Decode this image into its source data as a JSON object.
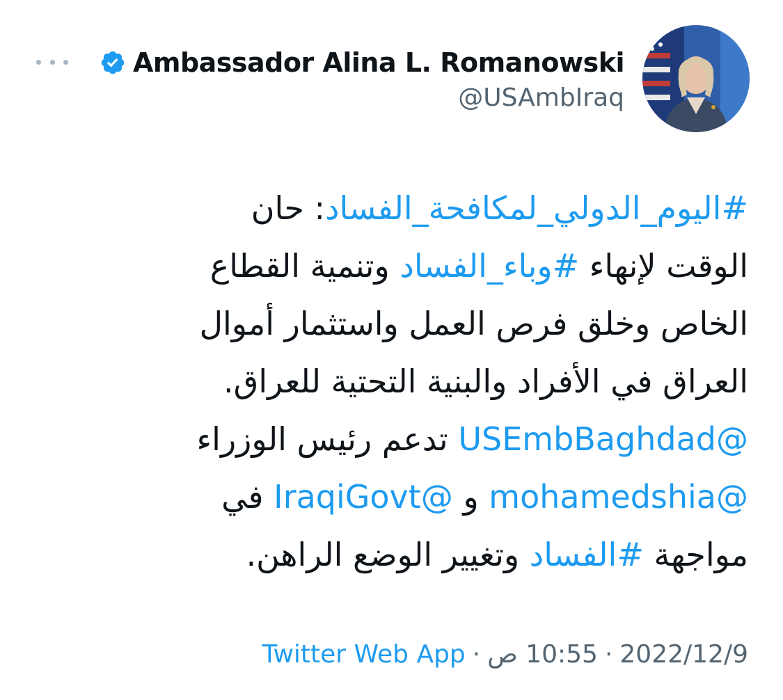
{
  "author": {
    "display_name": "Ambassador Alina L. Romanowski",
    "handle": "@USAmbIraq",
    "verified": true
  },
  "tweet": {
    "line1": {
      "hashtag": "#اليوم_الدولي_لمكافحة_الفساد",
      "text": ": حان"
    },
    "line2": {
      "before": "الوقت لإنهاء ",
      "hashtag": "#وباء_الفساد",
      "after": " وتنمية القطاع"
    },
    "line3": "الخاص وخلق فرص العمل واستثمار أموال",
    "line4": "العراق في الأفراد والبنية التحتية للعراق.",
    "line5": {
      "mention": "@USEmbBaghdad",
      "text": " تدعم رئيس الوزراء"
    },
    "line6": {
      "mention1": "@mohamedshia",
      "and": " و ",
      "mention2": "@IraqiGovt",
      "after": " في"
    },
    "line7": {
      "before": "مواجهة ",
      "hashtag": "#الفساد",
      "after": " وتغيير الوضع الراهن."
    }
  },
  "meta": {
    "date": "2022/12/9",
    "time": "10:55 ص",
    "separator": "·",
    "source": "Twitter Web App"
  },
  "colors": {
    "link": "#1d9bf0",
    "secondary_text": "#536471",
    "primary_text": "#0f1419"
  },
  "icons": {
    "more": "more-dots-icon",
    "verified": "verified-badge-icon"
  }
}
